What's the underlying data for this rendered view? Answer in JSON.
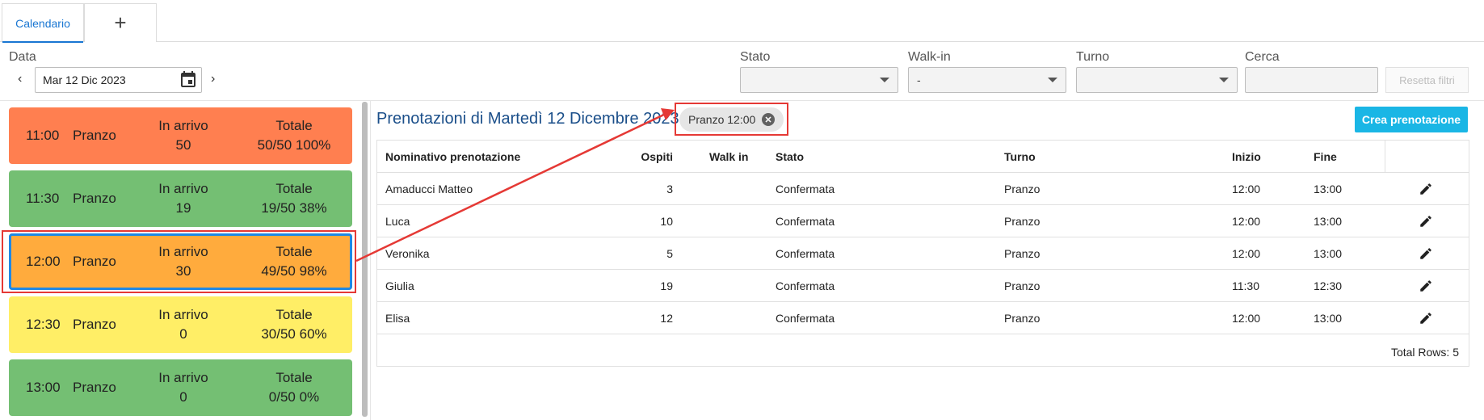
{
  "tabs": {
    "active": "Calendario",
    "add": "+"
  },
  "filters": {
    "date_label": "Data",
    "date_value": "Mar 12 Dic 2023",
    "stato_label": "Stato",
    "stato_value": "",
    "walkin_label": "Walk-in",
    "walkin_value": "-",
    "turno_label": "Turno",
    "turno_value": "",
    "cerca_label": "Cerca",
    "reset_label": "Resetta filtri"
  },
  "slots": [
    {
      "time": "11:00",
      "turno": "Pranzo",
      "arrivo_label": "In arrivo",
      "arrivo": "50",
      "totale_label": "Totale",
      "totale": "50/50 100%",
      "color": "#ff7f50"
    },
    {
      "time": "11:30",
      "turno": "Pranzo",
      "arrivo_label": "In arrivo",
      "arrivo": "19",
      "totale_label": "Totale",
      "totale": "19/50 38%",
      "color": "#74bf73"
    },
    {
      "time": "12:00",
      "turno": "Pranzo",
      "arrivo_label": "In arrivo",
      "arrivo": "30",
      "totale_label": "Totale",
      "totale": "49/50 98%",
      "color": "#ffab3d"
    },
    {
      "time": "12:30",
      "turno": "Pranzo",
      "arrivo_label": "In arrivo",
      "arrivo": "0",
      "totale_label": "Totale",
      "totale": "30/50 60%",
      "color": "#ffee66"
    },
    {
      "time": "13:00",
      "turno": "Pranzo",
      "arrivo_label": "In arrivo",
      "arrivo": "0",
      "totale_label": "Totale",
      "totale": "0/50 0%",
      "color": "#74bf73"
    }
  ],
  "main": {
    "title": "Prenotazioni di Martedì 12 Dicembre 2023",
    "chip": "Pranzo 12:00",
    "create_button": "Crea prenotazione",
    "total_rows": "Total Rows: 5"
  },
  "table": {
    "headers": [
      "Nominativo prenotazione",
      "Ospiti",
      "Walk in",
      "Stato",
      "Turno",
      "Inizio",
      "Fine"
    ],
    "rows": [
      [
        "Amaducci Matteo",
        "3",
        "",
        "Confermata",
        "Pranzo",
        "12:00",
        "13:00"
      ],
      [
        "Luca",
        "10",
        "",
        "Confermata",
        "Pranzo",
        "12:00",
        "13:00"
      ],
      [
        "Veronika",
        "5",
        "",
        "Confermata",
        "Pranzo",
        "12:00",
        "13:00"
      ],
      [
        "Giulia",
        "19",
        "",
        "Confermata",
        "Pranzo",
        "11:30",
        "12:30"
      ],
      [
        "Elisa",
        "12",
        "",
        "Confermata",
        "Pranzo",
        "12:00",
        "13:00"
      ]
    ]
  }
}
